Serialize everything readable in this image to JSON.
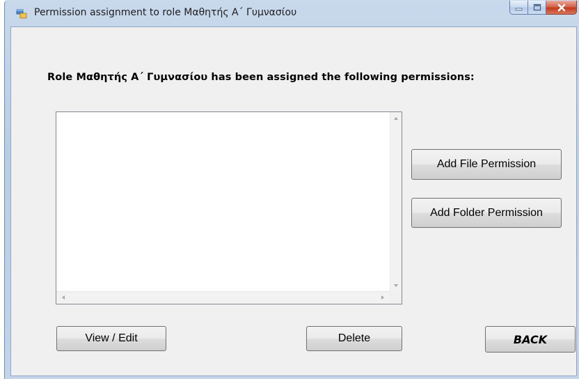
{
  "window": {
    "title": "Permission assignment to role Μαθητής Α΄ Γυμνασίου",
    "icon": "windows-form-icon",
    "caption_buttons": [
      "minimize",
      "maximize",
      "close"
    ]
  },
  "main": {
    "heading": "Role Μαθητής Α΄ Γυμνασίου has been assigned the following permissions:",
    "permissions_list": {
      "items": []
    }
  },
  "buttons": {
    "add_file": "Add File Permission",
    "add_folder": "Add Folder Permission",
    "view_edit": "View / Edit",
    "delete": "Delete",
    "back": "BACK"
  }
}
